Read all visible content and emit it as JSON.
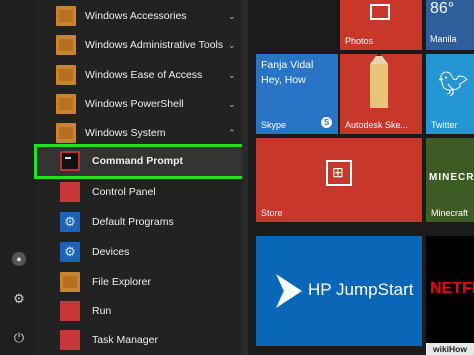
{
  "rail": {
    "user_icon": "user-icon",
    "settings_icon": "gear-icon",
    "power_icon": "power-icon"
  },
  "apps": {
    "folders": [
      {
        "label": "Windows Accessories"
      },
      {
        "label": "Windows Administrative Tools"
      },
      {
        "label": "Windows Ease of Access"
      },
      {
        "label": "Windows PowerShell"
      },
      {
        "label": "Windows System"
      }
    ],
    "system_items": [
      {
        "label": "Command Prompt",
        "highlighted": true
      },
      {
        "label": "Control Panel"
      },
      {
        "label": "Default Programs"
      },
      {
        "label": "Devices"
      },
      {
        "label": "File Explorer"
      },
      {
        "label": "Run"
      },
      {
        "label": "Task Manager"
      }
    ]
  },
  "tiles": {
    "photos": "Photos",
    "weather": {
      "temp": "86°",
      "city": "Manila"
    },
    "skype": {
      "user": "Fanja Vidal",
      "message": "Hey, How",
      "label": "Skype"
    },
    "autodesk": "Autodesk Ske...",
    "twitter": "Twitter",
    "store": "Store",
    "minecraft": {
      "logo_text": "MINECR",
      "label": "Minecraft"
    },
    "hp": "HP JumpStart",
    "netflix": "NETFL"
  },
  "watermark": "wikiHow",
  "colors": {
    "highlight": "#22e022",
    "accent_red": "#c7372a",
    "accent_blue": "#2a74c6"
  }
}
